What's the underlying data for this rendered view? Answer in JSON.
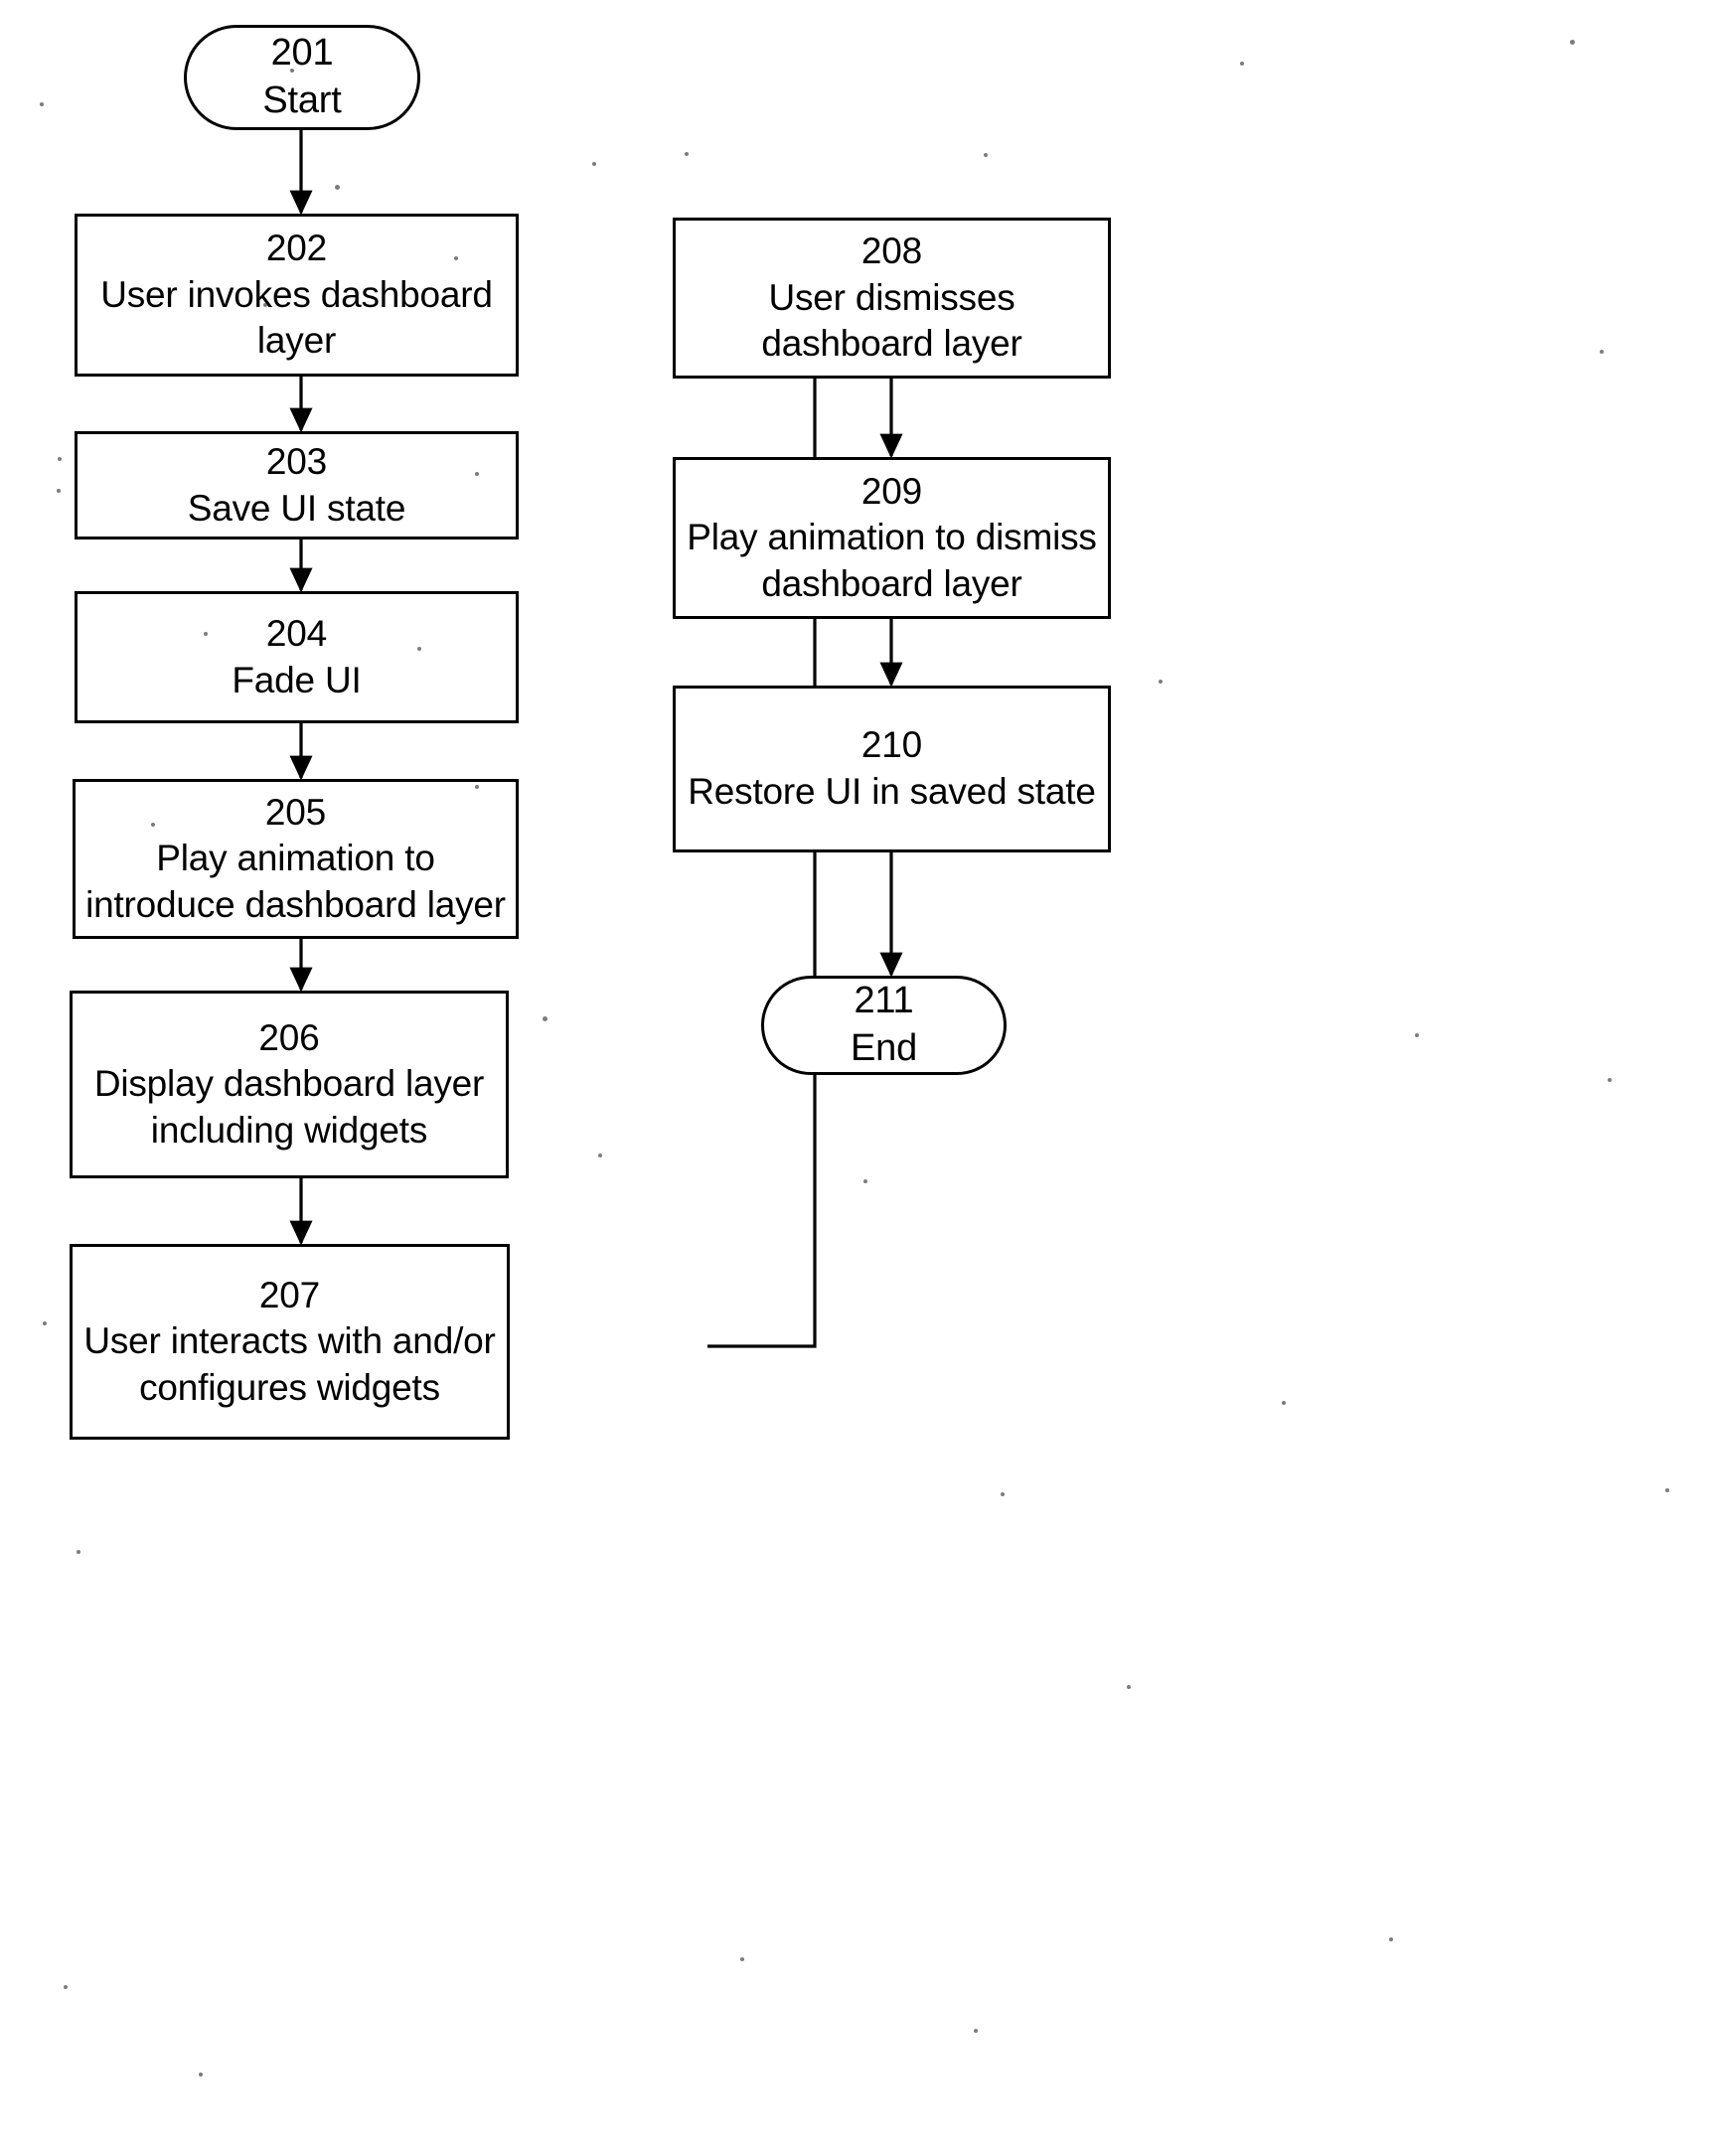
{
  "figure": {
    "kind": "flowchart",
    "orientation": "two-column, top-to-bottom"
  },
  "nodes": [
    {
      "id": "n201",
      "ref": "201",
      "label": "Start",
      "shape": "terminator",
      "column": "left"
    },
    {
      "id": "n202",
      "ref": "202",
      "label": "User invokes dashboard\nlayer",
      "shape": "process",
      "column": "left"
    },
    {
      "id": "n203",
      "ref": "203",
      "label": "Save UI state",
      "shape": "process",
      "column": "left"
    },
    {
      "id": "n204",
      "ref": "204",
      "label": "Fade UI",
      "shape": "process",
      "column": "left"
    },
    {
      "id": "n205",
      "ref": "205",
      "label": "Play animation to\nintroduce dashboard layer",
      "shape": "process",
      "column": "left"
    },
    {
      "id": "n206",
      "ref": "206",
      "label": "Display dashboard layer\nincluding widgets",
      "shape": "process",
      "column": "left"
    },
    {
      "id": "n207",
      "ref": "207",
      "label": "User interacts with and/or\nconfigures widgets",
      "shape": "process",
      "column": "left"
    },
    {
      "id": "n208",
      "ref": "208",
      "label": "User dismisses\ndashboard layer",
      "shape": "process",
      "column": "right"
    },
    {
      "id": "n209",
      "ref": "209",
      "label": "Play animation to dismiss\ndashboard layer",
      "shape": "process",
      "column": "right"
    },
    {
      "id": "n210",
      "ref": "210",
      "label": "Restore UI in saved state",
      "shape": "process",
      "column": "right"
    },
    {
      "id": "n211",
      "ref": "211",
      "label": "End",
      "shape": "terminator",
      "column": "right"
    }
  ],
  "edges": [
    {
      "id": "e201_202",
      "from": "201",
      "to": "202",
      "style": "straight-down"
    },
    {
      "id": "e202_203",
      "from": "202",
      "to": "203",
      "style": "straight-down"
    },
    {
      "id": "e203_204",
      "from": "203",
      "to": "204",
      "style": "straight-down"
    },
    {
      "id": "e204_205",
      "from": "204",
      "to": "205",
      "style": "straight-down"
    },
    {
      "id": "e205_206",
      "from": "205",
      "to": "206",
      "style": "straight-down"
    },
    {
      "id": "e206_207",
      "from": "206",
      "to": "207",
      "style": "straight-down"
    },
    {
      "id": "e207_208",
      "from": "207",
      "to": "208",
      "style": "orthogonal-right-up-right"
    },
    {
      "id": "e208_209",
      "from": "208",
      "to": "209",
      "style": "straight-down"
    },
    {
      "id": "e209_210",
      "from": "209",
      "to": "210",
      "style": "straight-down"
    },
    {
      "id": "e210_211",
      "from": "210",
      "to": "211",
      "style": "straight-down"
    }
  ],
  "style": {
    "ink": "#000000",
    "paper": "#ffffff",
    "stroke_width": 3
  }
}
